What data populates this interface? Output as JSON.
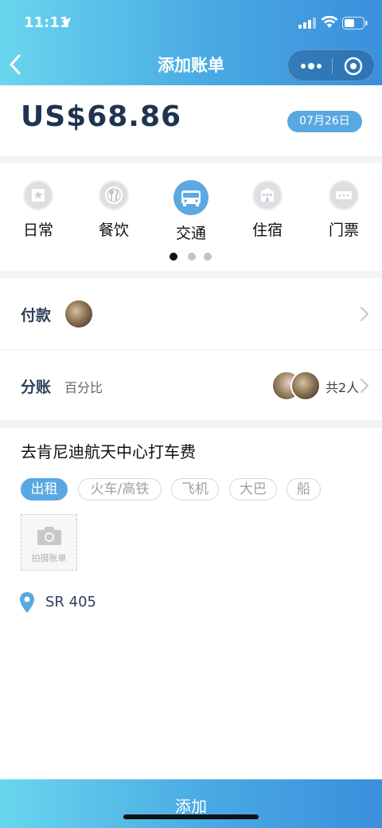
{
  "status": {
    "time": "11:11"
  },
  "header": {
    "title": "添加账单"
  },
  "amount": {
    "value": "US$68.86",
    "date": "07月26日"
  },
  "categories": [
    {
      "label": "日常",
      "icon": "daily-star-icon",
      "selected": false
    },
    {
      "label": "餐饮",
      "icon": "fork-knife-icon",
      "selected": false
    },
    {
      "label": "交通",
      "icon": "bus-icon",
      "selected": true
    },
    {
      "label": "住宿",
      "icon": "hotel-icon",
      "selected": false
    },
    {
      "label": "门票",
      "icon": "ticket-icon",
      "selected": false
    }
  ],
  "pager": {
    "count": 3,
    "active": 0
  },
  "payment": {
    "label": "付款"
  },
  "split": {
    "label": "分账",
    "mode": "百分比",
    "count": "共2人"
  },
  "detail": {
    "description": "去肯尼迪航天中心打车费",
    "tags": [
      {
        "label": "出租",
        "selected": true
      },
      {
        "label": "火车/高铁",
        "selected": false
      },
      {
        "label": "飞机",
        "selected": false
      },
      {
        "label": "大巴",
        "selected": false
      },
      {
        "label": "船",
        "selected": false
      }
    ],
    "photo_label": "拍摄账单",
    "location": "SR 405"
  },
  "footer": {
    "add_label": "添加"
  },
  "colors": {
    "accent": "#5aa8e1",
    "amount_text": "#1e3451",
    "label_text": "#2d3f5a"
  }
}
